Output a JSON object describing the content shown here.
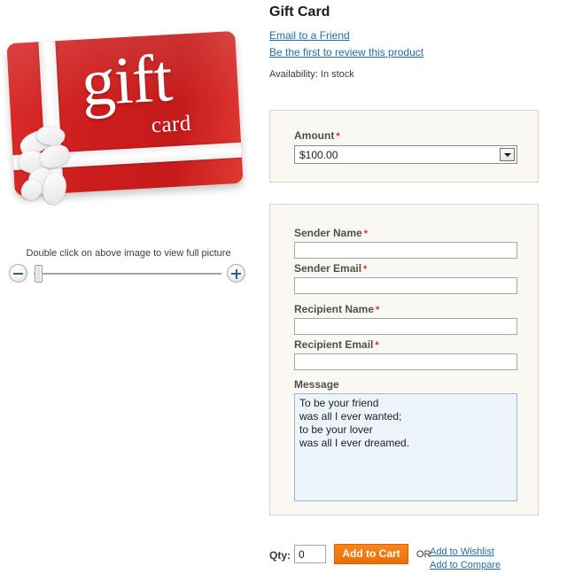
{
  "product": {
    "title": "Gift Card",
    "email_link": "Email to a Friend",
    "review_link": "Be the first to review this product",
    "availability_label": "Availability:",
    "availability_value": "In stock"
  },
  "media": {
    "card_title": "gift",
    "card_subtitle": "card",
    "card_color": "#cc1d1d",
    "zoom_hint": "Double click on above image to view full picture",
    "zoom_out_icon": "minus-circle-icon",
    "zoom_in_icon": "plus-circle-icon",
    "slider_value": "0"
  },
  "amount": {
    "label": "Amount",
    "required_marker": "*",
    "selected": "$100.00",
    "options": [
      "$100.00"
    ],
    "dropdown_icon": "chevron-down-icon"
  },
  "form": {
    "fields": [
      {
        "label": "Sender Name",
        "required_marker": "*",
        "value": "",
        "placeholder": ""
      },
      {
        "label": "Sender Email",
        "required_marker": "*",
        "value": "",
        "placeholder": ""
      },
      {
        "label": "Recipient Name",
        "required_marker": "*",
        "value": "",
        "placeholder": ""
      },
      {
        "label": "Recipient Email",
        "required_marker": "*",
        "value": "",
        "placeholder": ""
      }
    ],
    "message": {
      "label": "Message",
      "value": "To be your friend\nwas all I ever wanted;\nto be your lover\nwas all I ever dreamed.",
      "placeholder": ""
    }
  },
  "cart": {
    "qty_label": "Qty:",
    "qty_value": "0",
    "add_to_cart": "Add to Cart",
    "or": "OR",
    "wishlist": "Add to Wishlist",
    "compare": "Add to Compare",
    "button_color": "#f2720c"
  }
}
